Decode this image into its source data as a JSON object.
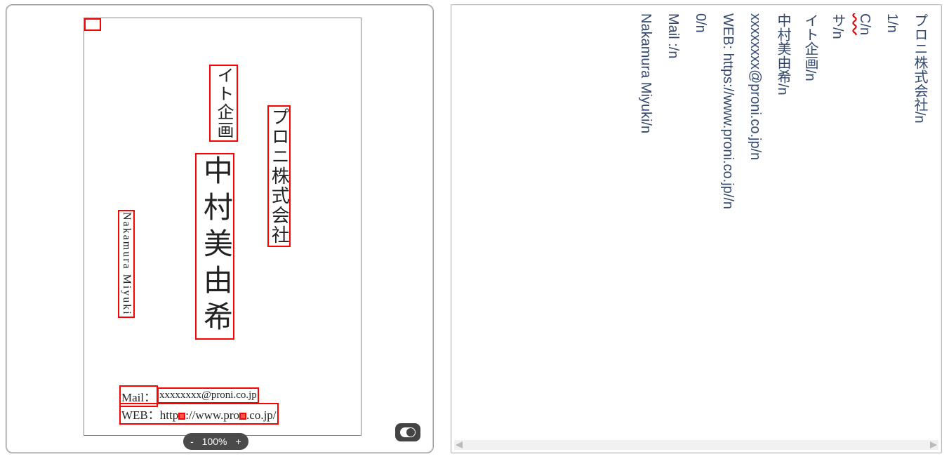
{
  "card": {
    "company": "プロニ株式会社",
    "department_stub": "",
    "department": "イト企画",
    "name": "中村美由希",
    "romaji": "Nakamura Miyuki",
    "mail_label": "Mail：",
    "mail_value": "xxxxxxxx@proni.co.jp",
    "web_line": "WEB：https://www.proni.co.jp/"
  },
  "web_parts": {
    "a": "WEB：http",
    "b": "://www.pro",
    "c": ".co.jp/"
  },
  "zoom": {
    "minus": "-",
    "value": "100%",
    "plus": "+"
  },
  "right_lines": [
    "プロニ株式会社/n",
    "1/n",
    "C/n",
    "サ/n",
    "イト企画/n",
    "中村美由希/n",
    "xxxxxxxx@proni.co.jp/n",
    "WEB: https://www.proni.co.jp//n",
    "0/n",
    "Mail :/n",
    "Nakamura Miyuki/n"
  ],
  "spellcheck_index": 2,
  "faint_label": ""
}
